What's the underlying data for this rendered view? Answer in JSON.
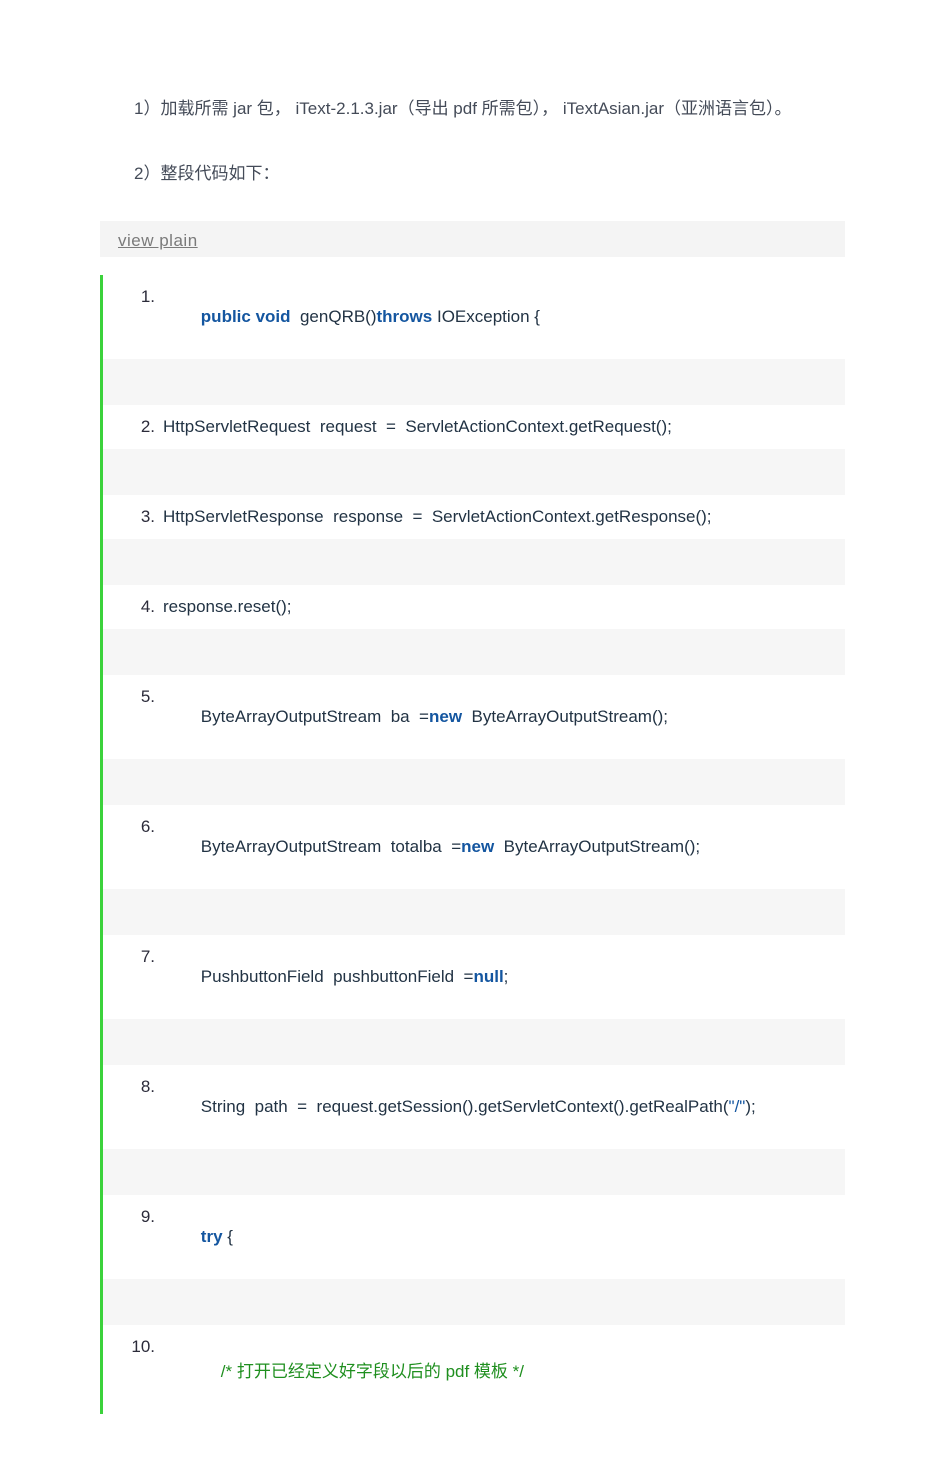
{
  "para1_prefix": "1）加载所需 jar 包，",
  "para1_jar1": "iText-2.1.3.jar（导出 pdf 所需包），",
  "para1_jar2": "iTextAsian.jar（亚洲语言包）。",
  "para2": "2）整段代码如下：",
  "view_plain": "view plain",
  "lines": {
    "l1_num": "1.",
    "l1_kw1": "public void",
    "l1_mid": "  genQRB()",
    "l1_kw2": "throws",
    "l1_end": " IOException {",
    "l2_num": "2.",
    "l2_txt": "HttpServletRequest  request  =  ServletActionContext.getRequest();",
    "l3_num": "3.",
    "l3_txt": "HttpServletResponse  response  =  ServletActionContext.getResponse();",
    "l4_num": "4.",
    "l4_txt": "response.reset();",
    "l5_num": "5.",
    "l5_a": "ByteArrayOutputStream  ba  =",
    "l5_kw": "new",
    "l5_b": "  ByteArrayOutputStream();",
    "l6_num": "6.",
    "l6_a": "ByteArrayOutputStream  totalba  =",
    "l6_kw": "new",
    "l6_b": "  ByteArrayOutputStream();",
    "l7_num": "7.",
    "l7_a": "PushbuttonField  pushbuttonField  =",
    "l7_kw": "null",
    "l7_b": ";",
    "l8_num": "8.",
    "l8_a": "String  path  =  request.getSession().getServletContext().getRealPath(",
    "l8_str": "\"/\"",
    "l8_b": ");",
    "l9_num": "9.",
    "l9_kw": "try",
    "l9_b": " {",
    "l10_num": "10.",
    "l10_cmt": "/* 打开已经定义好字段以后的 pdf 模板 */"
  }
}
